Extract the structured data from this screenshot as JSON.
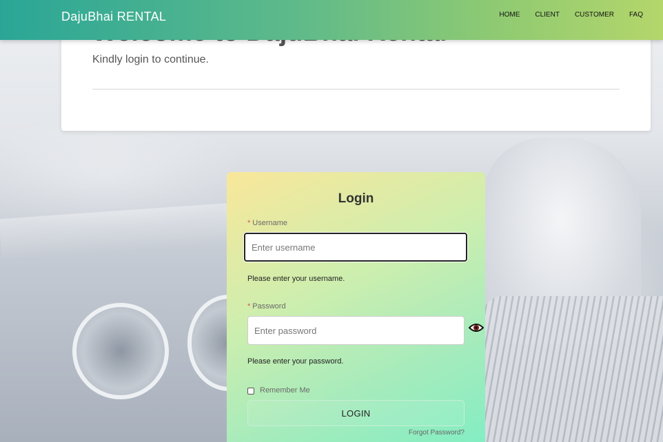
{
  "navbar": {
    "brand": "DajuBhai RENTAL",
    "links": [
      {
        "label": "HOME"
      },
      {
        "label": "CLIENT"
      },
      {
        "label": "CUSTOMER"
      },
      {
        "label": "FAQ"
      }
    ]
  },
  "welcome": {
    "title": "Welcome to DajuBhai Rental",
    "subtitle": "Kindly login to continue."
  },
  "login": {
    "title": "Login",
    "username": {
      "label": "Username",
      "placeholder": "Enter username",
      "help": "Please enter your username."
    },
    "password": {
      "label": "Password",
      "placeholder": "Enter password",
      "help": "Please enter your password.",
      "toggle_icon": "eye-icon"
    },
    "remember_label": "Remember Me",
    "submit_label": "LOGIN",
    "forgot_label": "Forgot Password?"
  },
  "colors": {
    "navbar_start": "#2aa697",
    "navbar_end": "#b4d66b",
    "card_start": "#f9e79a",
    "card_end": "#7feec3",
    "required": "#d9534f"
  }
}
